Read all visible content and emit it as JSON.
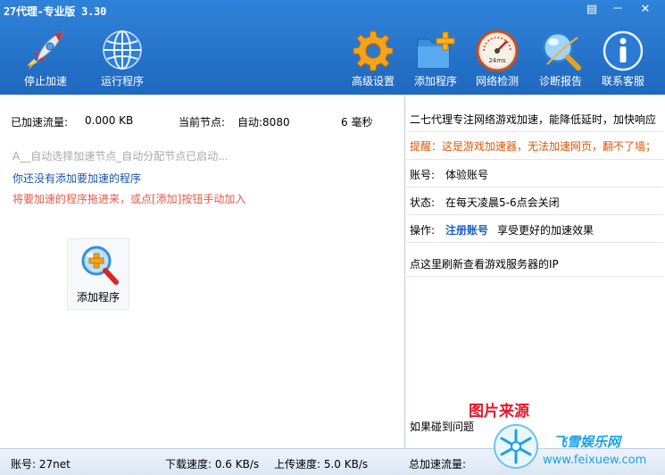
{
  "window": {
    "title": "27代理-专业版 3.30",
    "controls": {
      "menu": "▤",
      "minimize": "－",
      "close": "✕"
    }
  },
  "toolbar": {
    "stop": "停止加速",
    "run": "运行程序",
    "advanced": "高级设置",
    "add": "添加程序",
    "network": "网络检测",
    "diagnose": "诊断报告",
    "support": "联系客服"
  },
  "left": {
    "accel_flow_label": "已加速流量:",
    "accel_flow_value": "0.000 KB",
    "node_label": "当前节点:",
    "node_value": "自动:8080",
    "latency": "6 毫秒",
    "hint_gray": "A__自动选择加速节点_自动分配节点已启动...",
    "hint_blue": "你还没有添加要加速的程序",
    "hint_red": "将要加速的程序拖进来，或点[添加]按钮手动加入",
    "add_program": "添加程序"
  },
  "right": {
    "intro": "二七代理专注网络游戏加速，能降低延时，加快响应",
    "reminder": "提醒：这是游戏加速器，无法加速网页，翻不了墙；",
    "account_label": "账号:",
    "account_value": "体验账号",
    "status_label": "状态:",
    "status_value": "在每天凌晨5-6点会关闭",
    "action_label": "操作:",
    "register_link": "注册账号",
    "register_desc": "享受更好的加速效果",
    "refresh_ip": "点这里刷新查看游戏服务器的IP",
    "problem": "如果碰到问题"
  },
  "status": {
    "account": "账号: 27net",
    "download": "下载速度: 0.6 KB/s",
    "upload": "上传速度: 5.0 KB/s",
    "total": "总加速流量:"
  },
  "watermark": {
    "source": "图片来源",
    "site_cn": "飞雪娱乐网",
    "site_url": "www.feixuew.com"
  },
  "colors": {
    "toolbar_blue": "#2a78cf",
    "hint_gray": "#a8a8a8",
    "hint_blue": "#1a56a8",
    "hint_red": "#e35a4a",
    "reminder_orange": "#e0570a",
    "link_blue": "#1f5fbf",
    "watermark_red": "#e8142c",
    "watermark_blue": "#1aa0e8"
  }
}
